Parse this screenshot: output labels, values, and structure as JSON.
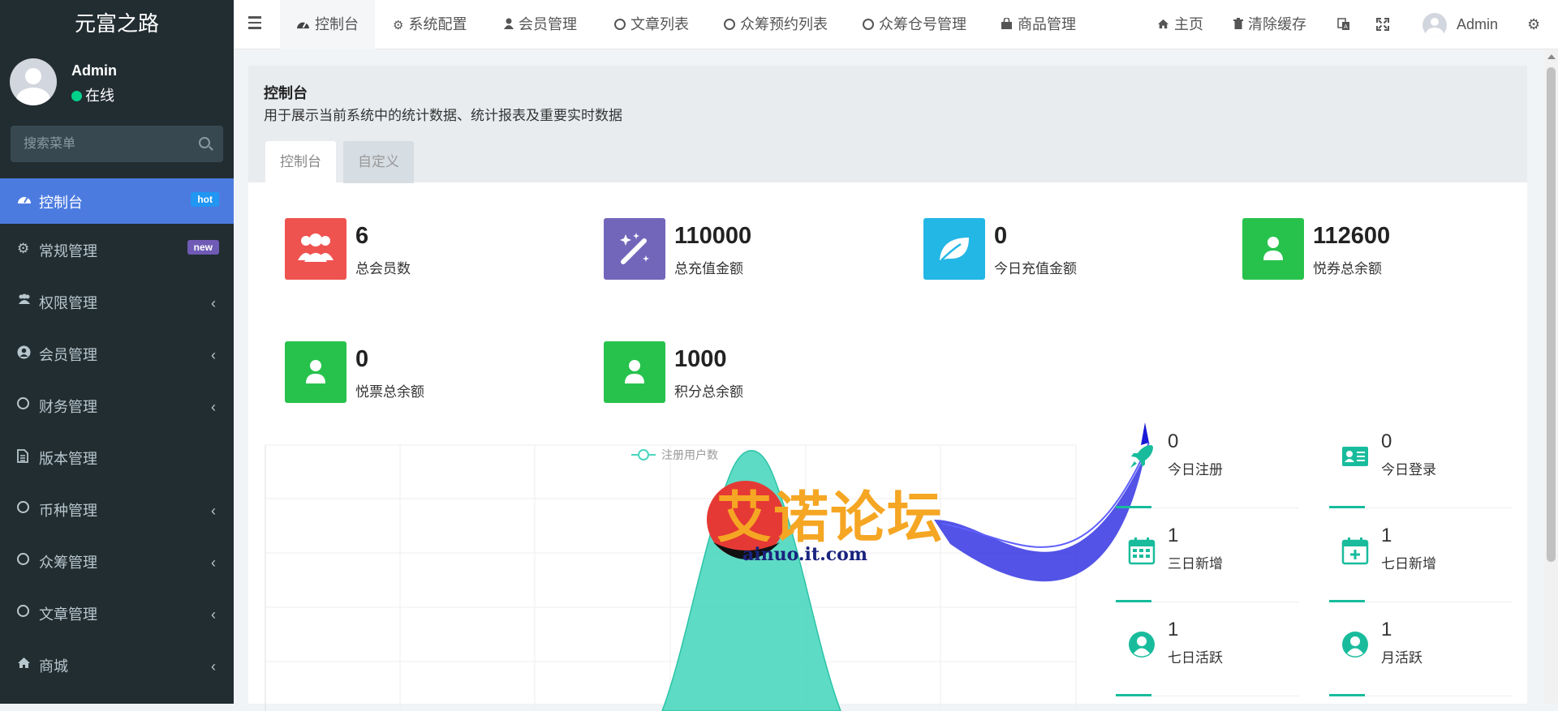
{
  "app": {
    "title": "元富之路"
  },
  "sidebar": {
    "user": {
      "name": "Admin",
      "status": "在线"
    },
    "search_placeholder": "搜索菜单",
    "items": [
      {
        "label": "控制台",
        "icon": "dashboard-icon",
        "badge": "hot",
        "badge_color": "#2196f3",
        "active": true
      },
      {
        "label": "常规管理",
        "icon": "cogs-icon",
        "badge": "new",
        "badge_color": "#6f5bb5"
      },
      {
        "label": "权限管理",
        "icon": "group-icon",
        "arrow": "‹"
      },
      {
        "label": "会员管理",
        "icon": "user-circle-icon",
        "arrow": "‹"
      },
      {
        "label": "财务管理",
        "icon": "circle-icon",
        "arrow": "‹"
      },
      {
        "label": "版本管理",
        "icon": "file-icon"
      },
      {
        "label": "币种管理",
        "icon": "circle-icon",
        "arrow": "‹"
      },
      {
        "label": "众筹管理",
        "icon": "circle-icon",
        "arrow": "‹"
      },
      {
        "label": "文章管理",
        "icon": "circle-icon",
        "arrow": "‹"
      },
      {
        "label": "商城",
        "icon": "home-icon",
        "arrow": "‹"
      }
    ]
  },
  "topbar": {
    "tabs": [
      {
        "label": "控制台",
        "icon": "dashboard-icon",
        "active": true
      },
      {
        "label": "系统配置",
        "icon": "cog-icon"
      },
      {
        "label": "会员管理",
        "icon": "user-icon"
      },
      {
        "label": "文章列表",
        "icon": "circle-icon"
      },
      {
        "label": "众筹预约列表",
        "icon": "circle-icon"
      },
      {
        "label": "众筹仓号管理",
        "icon": "circle-icon"
      },
      {
        "label": "商品管理",
        "icon": "shopping-bag-icon"
      }
    ],
    "home": "主页",
    "clear_cache": "清除缓存",
    "user": "Admin"
  },
  "page": {
    "title": "控制台",
    "description": "用于展示当前系统中的统计数据、统计报表及重要实时数据",
    "tabs": [
      "控制台",
      "自定义"
    ]
  },
  "stats": [
    {
      "value": "6",
      "label": "总会员数",
      "color": "#ef5350",
      "icon": "users-icon"
    },
    {
      "value": "110000",
      "label": "总充值金额",
      "color": "#7266ba",
      "icon": "magic-icon"
    },
    {
      "value": "0",
      "label": "今日充值金额",
      "color": "#23b7e5",
      "icon": "leaf-icon"
    },
    {
      "value": "112600",
      "label": "悦券总余额",
      "color": "#27c24c",
      "icon": "user-icon"
    },
    {
      "value": "0",
      "label": "悦票总余额",
      "color": "#27c24c",
      "icon": "user-icon"
    },
    {
      "value": "1000",
      "label": "积分总余额",
      "color": "#27c24c",
      "icon": "user-icon"
    }
  ],
  "mini_stats": [
    {
      "value": "0",
      "label": "今日注册",
      "icon": "rocket-icon"
    },
    {
      "value": "0",
      "label": "今日登录",
      "icon": "id-card-icon"
    },
    {
      "value": "1",
      "label": "三日新增",
      "icon": "calendar-icon"
    },
    {
      "value": "1",
      "label": "七日新增",
      "icon": "calendar-plus-icon"
    },
    {
      "value": "1",
      "label": "七日活跃",
      "icon": "user-circle-icon"
    },
    {
      "value": "1",
      "label": "月活跃",
      "icon": "user-circle-icon"
    }
  ],
  "chart_data": {
    "type": "area",
    "series": [
      {
        "name": "注册用户数",
        "color": "#48d6bd"
      }
    ],
    "legend": "top-center"
  },
  "watermark": {
    "title": "艾诺论坛",
    "url": "ainuo.it.com"
  }
}
